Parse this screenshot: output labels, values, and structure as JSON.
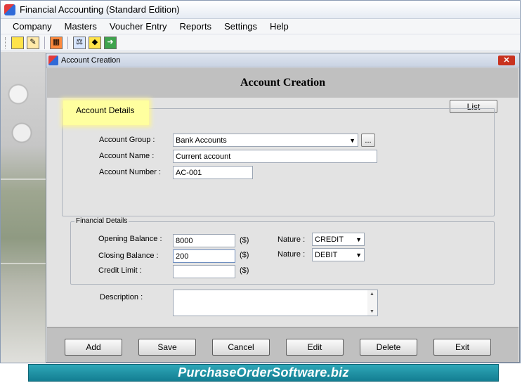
{
  "app": {
    "title": "Financial Accounting (Standard Edition)",
    "menu": [
      "Company",
      "Masters",
      "Voucher Entry",
      "Reports",
      "Settings",
      "Help"
    ]
  },
  "toolbar": {
    "icons": [
      "new-icon",
      "edit-icon",
      "calculator-icon",
      "balance-icon",
      "tag-icon",
      "exit-icon"
    ]
  },
  "child_window": {
    "title": "Account Creation",
    "close_label": "✕",
    "heading": "Account Creation",
    "list_label": "List"
  },
  "account_details": {
    "legend": "Account Details",
    "group_label": "Account Group :",
    "group_value": "Bank Accounts",
    "browse_label": "...",
    "name_label": "Account Name :",
    "name_value": "Current account",
    "number_label": "Account Number :",
    "number_value": "AC-001"
  },
  "financial_details": {
    "legend": "Financial Details",
    "opening_label": "Opening Balance :",
    "opening_value": "8000",
    "closing_label": "Closing Balance :",
    "closing_value": "200",
    "credit_limit_label": "Credit Limit :",
    "credit_limit_value": "",
    "currency": "($)",
    "nature_label": "Nature :",
    "opening_nature": "CREDIT",
    "closing_nature": "DEBIT"
  },
  "description": {
    "label": "Description :",
    "value": ""
  },
  "buttons": {
    "add": "Add",
    "save": "Save",
    "cancel": "Cancel",
    "edit": "Edit",
    "delete": "Delete",
    "exit": "Exit"
  },
  "footer": {
    "text": "PurchaseOrderSoftware.biz"
  },
  "colors": {
    "highlight": "#ffff9f",
    "footer_band": "#1a8fa3",
    "close_button": "#c8321f"
  }
}
